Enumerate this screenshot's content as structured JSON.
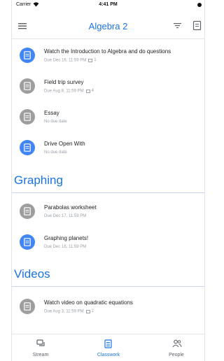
{
  "colors": {
    "accent": "#1a73e8",
    "assignment_active": "#4285f4",
    "assignment_inactive": "#9e9e9e",
    "divider": "#c5d5ef"
  },
  "status_bar": {
    "carrier": "Carrier",
    "time": "4:41 PM"
  },
  "app_bar": {
    "title": "Algebra 2",
    "menu_icon": "hamburger-menu-icon",
    "filter_icon": "filter-icon",
    "folder_icon": "drive-folder-icon"
  },
  "items_top": [
    {
      "title": "Watch the Introduction to Algebra and do questions",
      "due": "Due Dec 16, 11:59 PM",
      "attachments": "1",
      "status": "active"
    },
    {
      "title": "Field trip survey",
      "due": "Due Aug 8, 11:59 PM",
      "attachments": "4",
      "status": "inactive"
    },
    {
      "title": "Essay",
      "due": "No due date",
      "attachments": "",
      "status": "inactive"
    },
    {
      "title": "Drive Open With",
      "due": "No due date",
      "attachments": "",
      "status": "active"
    }
  ],
  "sections": [
    {
      "title": "Graphing",
      "items": [
        {
          "title": "Parabolas worksheet",
          "due": "Due Dec 17, 11:59 PM",
          "attachments": "",
          "status": "inactive"
        },
        {
          "title": "Graphing planets!",
          "due": "Due Dec 16, 11:59 PM",
          "attachments": "",
          "status": "active"
        }
      ]
    },
    {
      "title": "Videos",
      "items": [
        {
          "title": "Watch video on quadratic equations",
          "due": "Due Aug 3, 11:59 PM",
          "attachments": "2",
          "status": "inactive"
        }
      ]
    }
  ],
  "bottom_nav": [
    {
      "label": "Stream",
      "icon": "stream-icon",
      "active": false
    },
    {
      "label": "Classwork",
      "icon": "classwork-icon",
      "active": true
    },
    {
      "label": "People",
      "icon": "people-icon",
      "active": false
    }
  ]
}
